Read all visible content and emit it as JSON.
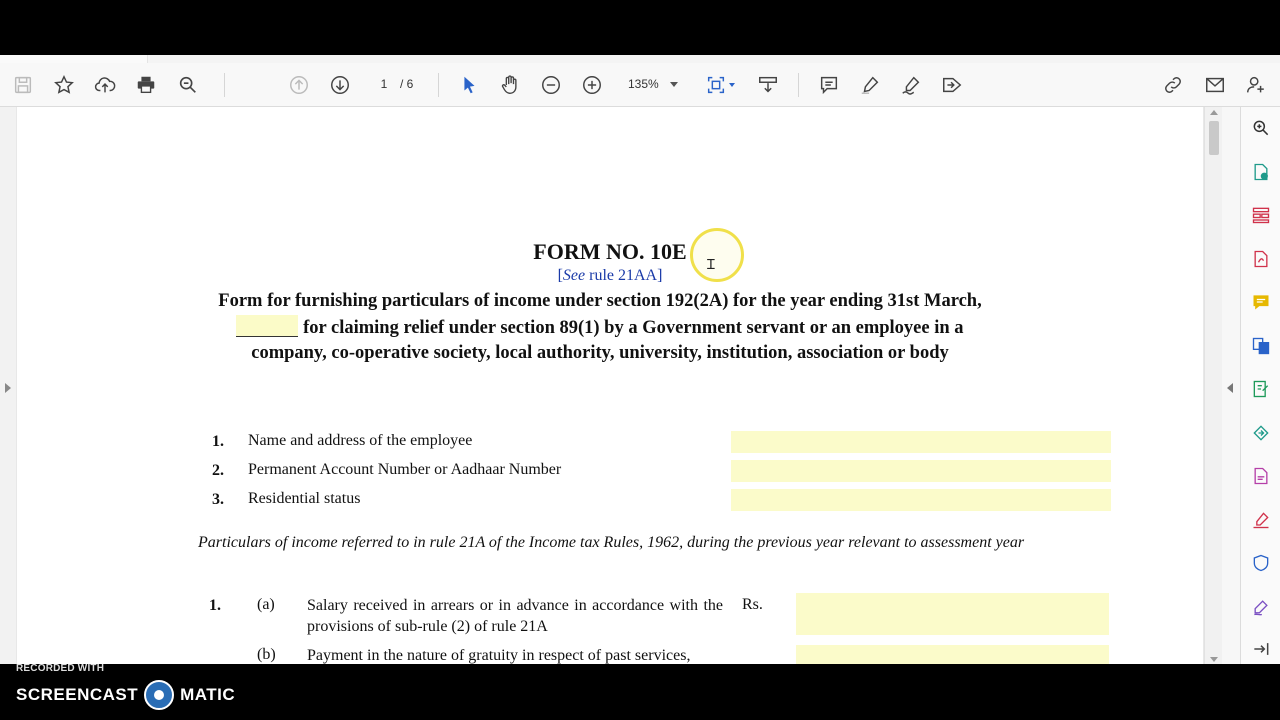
{
  "toolbar": {
    "page_current": "1",
    "page_total": "/ 6",
    "zoom": "135%",
    "icons": [
      "save-icon",
      "bookmark-star-icon",
      "upload-icon",
      "print-icon",
      "find-icon",
      "prev-page-icon",
      "next-page-icon",
      "select-cursor-icon",
      "hand-tool-icon",
      "zoom-out-icon",
      "zoom-in-icon",
      "fit-page-icon",
      "scroll-mode-icon",
      "comment-icon",
      "highlight-icon",
      "sign-icon",
      "share-icon",
      "link-icon",
      "email-icon",
      "add-user-icon"
    ]
  },
  "document": {
    "title": "FORM NO. 10E",
    "subtitle_prefix": "[",
    "subtitle_italic": "See",
    "subtitle_rest": " rule 21AA]",
    "desc_part1": "Form for furnishing particulars of income under section 192(2A) for the year ending 31st March,",
    "desc_part2": " for claiming relief under section 89(1) by a Government servant or an employee in a company, co-operative society, local authority, university, institution, association or body",
    "items": [
      {
        "num": "1.",
        "label": "Name and address of the employee"
      },
      {
        "num": "2.",
        "label": "Permanent Account Number or Aadhaar Number"
      },
      {
        "num": "3.",
        "label": "Residential status"
      }
    ],
    "particulars": "Particulars of income referred to in rule 21A of the Income tax Rules, 1962, during the previous year relevant to assessment year",
    "table": {
      "row_num": "1.",
      "rows": [
        {
          "sub": "(a)",
          "text": "Salary received in arrears or in advance in accordance with the provisions of sub-rule (2) of rule 21A",
          "unit": "Rs."
        },
        {
          "sub": "(b)",
          "text": "Payment in the nature of gratuity in respect of past services,",
          "unit": ""
        }
      ]
    }
  },
  "watermark": {
    "recorded": "RECORDED WITH",
    "brand_left": "SCREENCAST",
    "brand_right": "MATIC"
  },
  "colors": {
    "field_fill": "#fbfbca",
    "link_blue": "#1a3aa8",
    "cursor_ring": "#f0e04a"
  }
}
